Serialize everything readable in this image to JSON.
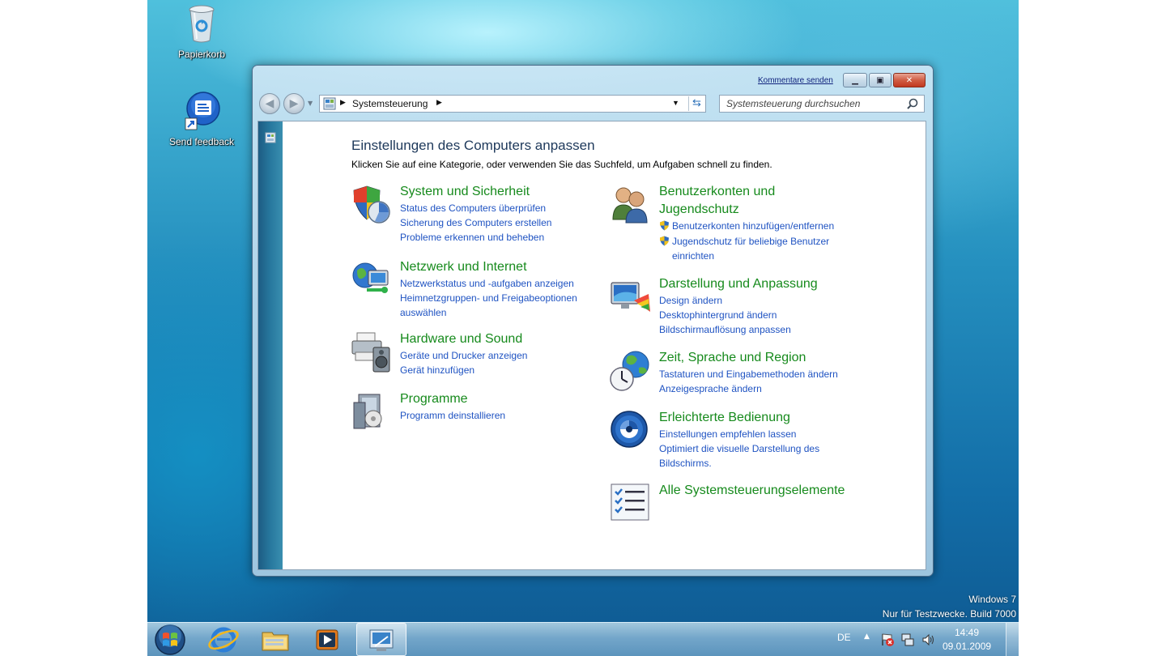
{
  "desktop": {
    "icons": [
      {
        "label": "Papierkorb",
        "icon": "recycle-bin-icon"
      },
      {
        "label": "Send feedback",
        "icon": "feedback-icon"
      }
    ],
    "watermark": {
      "line1": "Windows 7",
      "line2": "Nur für Testzwecke. Build 7000"
    }
  },
  "window": {
    "feedback_link": "Kommentare senden",
    "address": {
      "crumb": "Systemsteuerung"
    },
    "search_placeholder": "Systemsteuerung durchsuchen",
    "title": "Einstellungen des Computers anpassen",
    "subtitle": "Klicken Sie auf eine Kategorie, oder verwenden Sie das Suchfeld, um Aufgaben schnell zu finden.",
    "left_column": [
      {
        "title": "System und Sicherheit",
        "icon": "security-shield-icon",
        "links": [
          "Status des Computers überprüfen",
          "Sicherung des Computers erstellen",
          "Probleme erkennen und beheben"
        ]
      },
      {
        "title": "Netzwerk und Internet",
        "icon": "network-globe-icon",
        "links": [
          "Netzwerkstatus und -aufgaben anzeigen",
          "Heimnetzgruppen- und Freigabeoptionen",
          "auswählen"
        ]
      },
      {
        "title": "Hardware und Sound",
        "icon": "printer-speaker-icon",
        "links": [
          "Geräte und Drucker anzeigen",
          "Gerät hinzufügen"
        ]
      },
      {
        "title": "Programme",
        "icon": "programs-box-icon",
        "links": [
          "Programm deinstallieren"
        ]
      }
    ],
    "right_column": [
      {
        "title_line1": "Benutzerkonten und",
        "title_line2": "Jugendschutz",
        "icon": "users-icon",
        "links": [
          "Benutzerkonten hinzufügen/entfernen",
          "Jugendschutz für beliebige Benutzer",
          "einrichten"
        ]
      },
      {
        "title": "Darstellung und Anpassung",
        "icon": "display-palette-icon",
        "links": [
          "Design ändern",
          "Desktophintergrund ändern",
          "Bildschirmauflösung anpassen"
        ]
      },
      {
        "title": "Zeit, Sprache und Region",
        "icon": "clock-globe-icon",
        "links": [
          "Tastaturen und Eingabemethoden ändern",
          "Anzeigesprache ändern"
        ]
      },
      {
        "title": "Erleichterte Bedienung",
        "icon": "accessibility-icon",
        "links": [
          "Einstellungen empfehlen lassen",
          "Optimiert die visuelle Darstellung des",
          "Bildschirms."
        ]
      },
      {
        "title": "Alle Systemsteuerungselemente",
        "icon": "checklist-icon",
        "links": []
      }
    ]
  },
  "taskbar": {
    "language": "DE",
    "time": "14:49",
    "date": "09.01.2009",
    "buttons": [
      "start-orb-icon",
      "internet-explorer-icon",
      "explorer-folder-icon",
      "media-player-icon",
      "control-panel-icon"
    ]
  }
}
